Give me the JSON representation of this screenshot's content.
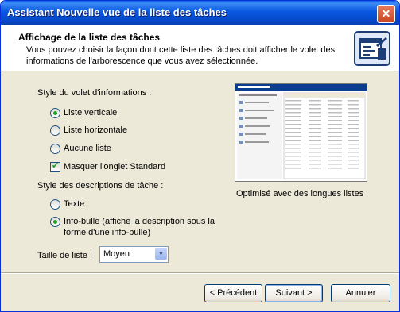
{
  "window": {
    "title": "Assistant Nouvelle vue de la liste des tâches",
    "close_glyph": "✕"
  },
  "header": {
    "title": "Affichage de la liste des tâches",
    "description": "Vous pouvez choisir la façon dont cette liste des tâches doit afficher le volet des informations de l'arborescence que vous avez sélectionnée."
  },
  "info_pane": {
    "label": "Style du volet d'informations :",
    "options": [
      {
        "label": "Liste verticale",
        "selected": true
      },
      {
        "label": "Liste horizontale",
        "selected": false
      },
      {
        "label": "Aucune liste",
        "selected": false
      }
    ],
    "hide_standard_tab": {
      "label": "Masquer l'onglet Standard",
      "checked": true
    }
  },
  "task_desc": {
    "label": "Style des descriptions de tâche :",
    "options": [
      {
        "label": "Texte",
        "selected": false
      },
      {
        "label": "Info-bulle (affiche la description sous la forme d'une info-bulle)",
        "selected": true
      }
    ]
  },
  "list_size": {
    "label": "Taille de liste :",
    "value": "Moyen"
  },
  "preview": {
    "caption": "Optimisé avec des longues listes"
  },
  "buttons": {
    "back": "< Précédent",
    "next": "Suivant >",
    "cancel": "Annuler"
  }
}
